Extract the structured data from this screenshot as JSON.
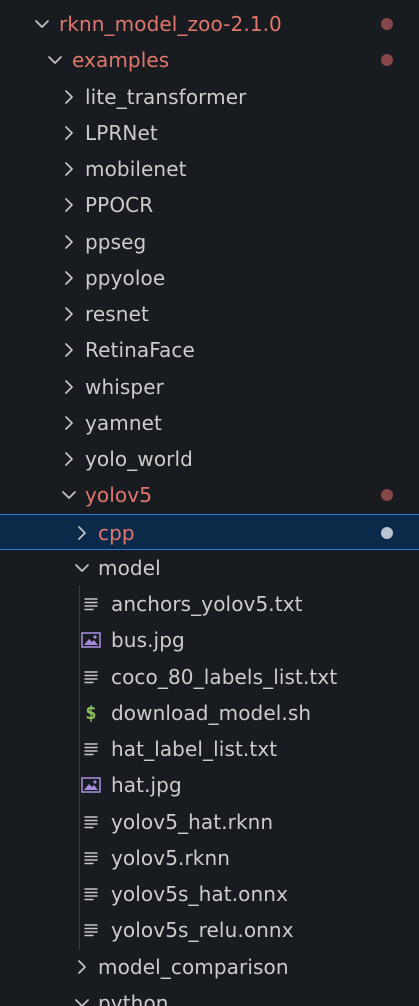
{
  "explorer": {
    "items": [
      {
        "label": "rknn_model_zoo-2.1.0",
        "kind": "folder",
        "expanded": true,
        "modified": true,
        "depth": 0
      },
      {
        "label": "examples",
        "kind": "folder",
        "expanded": true,
        "modified": true,
        "depth": 1
      },
      {
        "label": "lite_transformer",
        "kind": "folder",
        "expanded": false,
        "modified": false,
        "depth": 2
      },
      {
        "label": "LPRNet",
        "kind": "folder",
        "expanded": false,
        "modified": false,
        "depth": 2
      },
      {
        "label": "mobilenet",
        "kind": "folder",
        "expanded": false,
        "modified": false,
        "depth": 2
      },
      {
        "label": "PPOCR",
        "kind": "folder",
        "expanded": false,
        "modified": false,
        "depth": 2
      },
      {
        "label": "ppseg",
        "kind": "folder",
        "expanded": false,
        "modified": false,
        "depth": 2
      },
      {
        "label": "ppyoloe",
        "kind": "folder",
        "expanded": false,
        "modified": false,
        "depth": 2
      },
      {
        "label": "resnet",
        "kind": "folder",
        "expanded": false,
        "modified": false,
        "depth": 2
      },
      {
        "label": "RetinaFace",
        "kind": "folder",
        "expanded": false,
        "modified": false,
        "depth": 2
      },
      {
        "label": "whisper",
        "kind": "folder",
        "expanded": false,
        "modified": false,
        "depth": 2
      },
      {
        "label": "yamnet",
        "kind": "folder",
        "expanded": false,
        "modified": false,
        "depth": 2
      },
      {
        "label": "yolo_world",
        "kind": "folder",
        "expanded": false,
        "modified": false,
        "depth": 2
      },
      {
        "label": "yolov5",
        "kind": "folder",
        "expanded": true,
        "modified": true,
        "depth": 2
      },
      {
        "label": "cpp",
        "kind": "folder",
        "expanded": false,
        "modified": true,
        "selected": true,
        "depth": 3
      },
      {
        "label": "model",
        "kind": "folder",
        "expanded": true,
        "modified": false,
        "depth": 3
      },
      {
        "label": "anchors_yolov5.txt",
        "kind": "file",
        "icon": "text-file-icon",
        "depth": 4
      },
      {
        "label": "bus.jpg",
        "kind": "file",
        "icon": "image-file-icon",
        "depth": 4
      },
      {
        "label": "coco_80_labels_list.txt",
        "kind": "file",
        "icon": "text-file-icon",
        "depth": 4
      },
      {
        "label": "download_model.sh",
        "kind": "file",
        "icon": "shell-script-icon",
        "depth": 4
      },
      {
        "label": "hat_label_list.txt",
        "kind": "file",
        "icon": "text-file-icon",
        "depth": 4
      },
      {
        "label": "hat.jpg",
        "kind": "file",
        "icon": "image-file-icon",
        "depth": 4
      },
      {
        "label": "yolov5_hat.rknn",
        "kind": "file",
        "icon": "text-file-icon",
        "depth": 4
      },
      {
        "label": "yolov5.rknn",
        "kind": "file",
        "icon": "text-file-icon",
        "depth": 4
      },
      {
        "label": "yolov5s_hat.onnx",
        "kind": "file",
        "icon": "text-file-icon",
        "depth": 4
      },
      {
        "label": "yolov5s_relu.onnx",
        "kind": "file",
        "icon": "text-file-icon",
        "depth": 4
      },
      {
        "label": "model_comparison",
        "kind": "folder",
        "expanded": false,
        "modified": false,
        "depth": 3
      },
      {
        "label": "python",
        "kind": "folder",
        "expanded": true,
        "modified": false,
        "depth": 3
      }
    ]
  },
  "colors": {
    "background": "#181c20",
    "text": "#cccccc",
    "modified_text": "#e0766c",
    "modified_dot": "#86474a",
    "selection_bg": "#0b2a49",
    "selection_border": "#2f7ad1",
    "shell_icon": "#8fc15a",
    "image_icon": "#a58bd8"
  }
}
